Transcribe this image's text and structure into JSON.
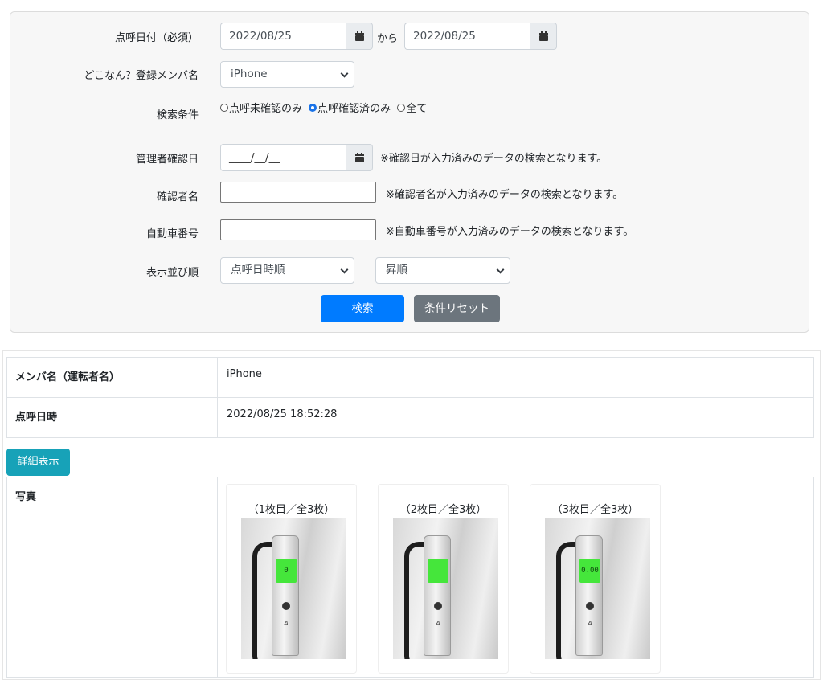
{
  "search": {
    "date_label": "点呼日付（必須）",
    "date_from": "2022/08/25",
    "date_sep": "から",
    "date_to": "2022/08/25",
    "member_label": "どこなん？登録メンバ名",
    "member_value": "iPhone",
    "condition_label": "検索条件",
    "radios": [
      {
        "label": "点呼未確認のみ",
        "checked": false
      },
      {
        "label": "点呼確認済のみ",
        "checked": true
      },
      {
        "label": "全て",
        "checked": false
      }
    ],
    "admin_date_label": "管理者確認日",
    "admin_date_value": "____/__/__",
    "admin_date_note": "※確認日が入力済みのデータの検索となります。",
    "confirmer_label": "確認者名",
    "confirmer_note": "※確認者名が入力済みのデータの検索となります。",
    "car_label": "自動車番号",
    "car_note": "※自動車番号が入力済みのデータの検索となります。",
    "sort_label": "表示並び順",
    "sort_field": "点呼日時順",
    "sort_order": "昇順",
    "search_button": "検索",
    "reset_button": "条件リセット"
  },
  "result": {
    "member_header": "メンバ名（運転者名）",
    "member_value": "iPhone",
    "datetime_header": "点呼日時",
    "datetime_value": "2022/08/25 18:52:28",
    "detail_button": "詳細表示",
    "photo_header": "写真",
    "photos": [
      {
        "caption": "（1枚目／全3枚）",
        "reading": "0"
      },
      {
        "caption": "（2枚目／全3枚）",
        "reading": ""
      },
      {
        "caption": "（3枚目／全3枚）",
        "reading": "0.00"
      }
    ]
  }
}
